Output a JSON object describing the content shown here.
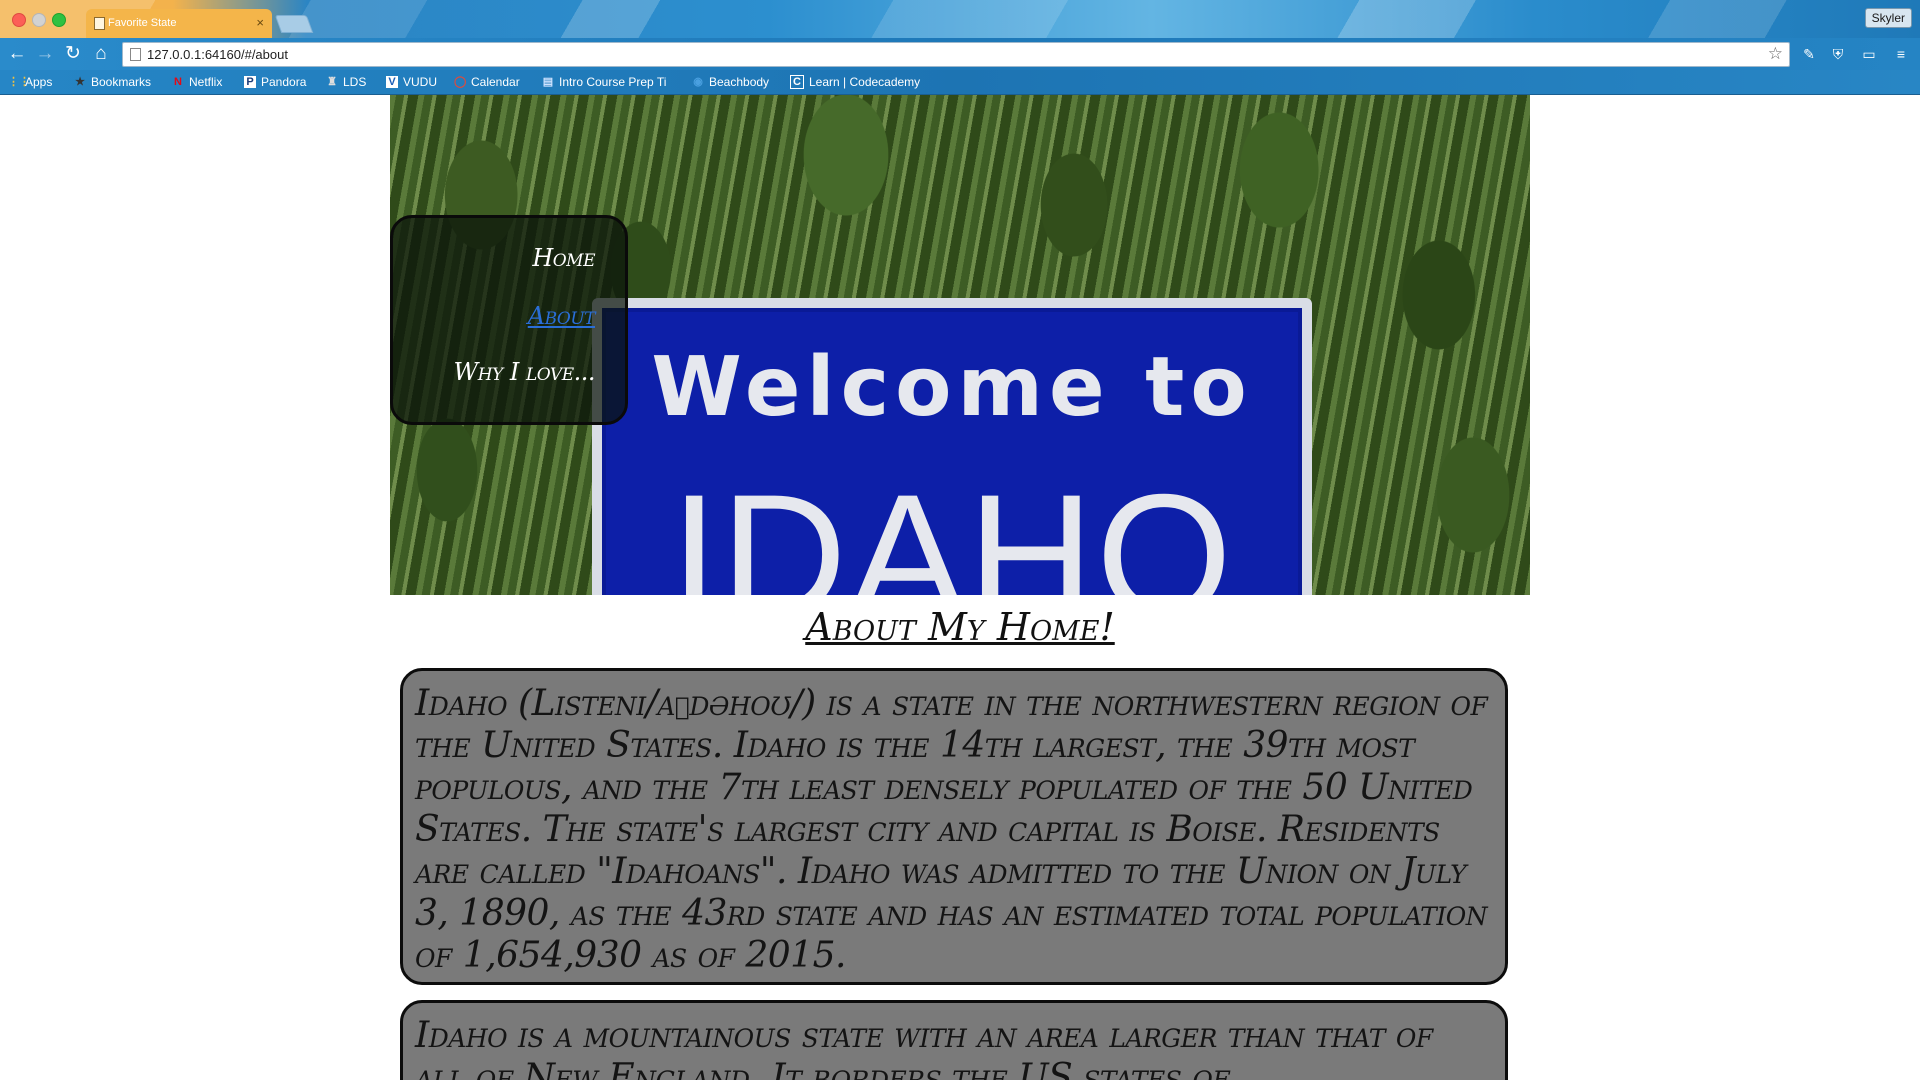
{
  "browser": {
    "tab_title": "Favorite State",
    "tab_close": "×",
    "profile_name": "Skyler",
    "url": "127.0.0.1:64160/#/about",
    "star_icon": "star-icon",
    "bookmarks": [
      {
        "label": "Apps",
        "icon": "apps-grid-icon",
        "glyph": "⋮⋮"
      },
      {
        "label": "Bookmarks",
        "icon": "star-icon",
        "glyph": "★"
      },
      {
        "label": "Netflix",
        "icon": "netflix-icon",
        "glyph": "N"
      },
      {
        "label": "Pandora",
        "icon": "pandora-icon",
        "glyph": "P"
      },
      {
        "label": "LDS",
        "icon": "lds-icon",
        "glyph": "♜"
      },
      {
        "label": "VUDU",
        "icon": "vudu-icon",
        "glyph": "V"
      },
      {
        "label": "Calendar",
        "icon": "calendar-icon",
        "glyph": "◯"
      },
      {
        "label": "Intro Course Prep Ti",
        "icon": "document-icon",
        "glyph": "▤"
      },
      {
        "label": "Beachbody",
        "icon": "beachbody-icon",
        "glyph": "◉"
      },
      {
        "label": "Learn | Codecademy",
        "icon": "codecademy-icon",
        "glyph": "C"
      }
    ]
  },
  "hero": {
    "sign_line1": "Welcome to",
    "sign_line2": "IDAHO"
  },
  "nav": {
    "home": "Home",
    "about": "About",
    "why": "Why I love..."
  },
  "main": {
    "title": "About My Home!",
    "paragraphs": [
      "Idaho (Listeni/aɪdəhoʊ/) is a state in the northwestern region of the United States. Idaho is the 14th largest, the 39th most populous, and the 7th least densely populated of the 50 United States. The state's largest city and capital is Boise. Residents are called \"Idahoans\". Idaho was admitted to the Union on July 3, 1890, as the 43rd state and has an estimated total population of 1,654,930 as of 2015.",
      "Idaho is a mountainous state with an area larger than that of all of New England. It borders the US states of"
    ]
  },
  "colors": {
    "card_bg": "#7a7a7a",
    "link_active": "#2a6ed8",
    "sign_blue": "#0d1fa8"
  }
}
